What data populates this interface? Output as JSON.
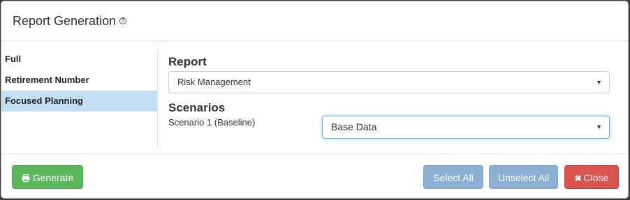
{
  "dialog": {
    "title": "Report Generation",
    "help_icon": "?"
  },
  "sidebar": {
    "items": [
      {
        "label": "Full",
        "active": false
      },
      {
        "label": "Retirement Number",
        "active": false
      },
      {
        "label": "Focused Planning",
        "active": true
      }
    ]
  },
  "report": {
    "heading": "Report",
    "selected": "Risk Management"
  },
  "scenarios": {
    "heading": "Scenarios",
    "rows": [
      {
        "label": "Scenario 1 (Baseline)",
        "selected": "Base Data"
      }
    ]
  },
  "footer": {
    "generate_label": "Generate",
    "generate_icon": "printer-icon",
    "select_all_label": "Select All",
    "unselect_all_label": "Unselect All",
    "close_label": "Close",
    "close_icon": "close-icon"
  },
  "colors": {
    "generate": "#5cb85c",
    "select": "#8cb0d3",
    "close": "#d9534f",
    "active_item": "#c3e0f5"
  }
}
